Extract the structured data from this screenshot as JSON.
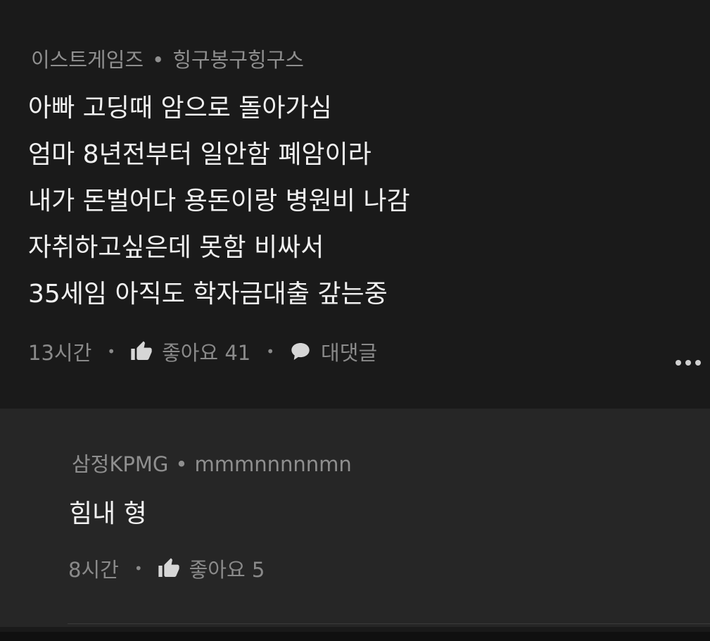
{
  "comment": {
    "game": "이스트게임즈",
    "author": "힝구봉구힝구스",
    "separator": "•",
    "lines": [
      "아빠 고딩때 암으로 돌아가심",
      "엄마 8년전부터 일안함 폐암이라",
      "내가 돈벌어다 용돈이랑 병원비 나감",
      "자취하고싶은데 못함 비싸서",
      "35세임 아직도 학자금대출 갚는중"
    ],
    "time": "13시간",
    "like_label": "좋아요 41",
    "reply_label": "대댓글",
    "icons": {
      "like": "thumbs-up-icon",
      "reply": "speech-bubble-icon",
      "more": "more-dots-icon"
    }
  },
  "reply": {
    "game": "삼정KPMG",
    "author": "mmmnnnnnmn",
    "separator": "•",
    "text": "힘내 형",
    "time": "8시간",
    "like_label": "좋아요 5"
  }
}
